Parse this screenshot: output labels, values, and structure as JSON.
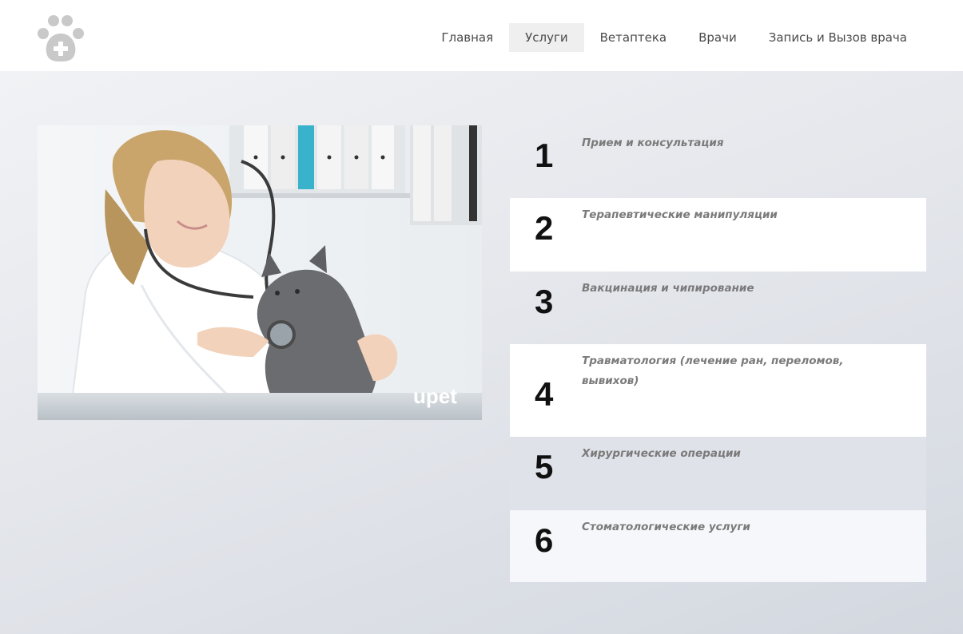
{
  "nav": {
    "items": [
      {
        "label": "Главная",
        "active": false
      },
      {
        "label": "Услуги",
        "active": true
      },
      {
        "label": "Ветаптека",
        "active": false
      },
      {
        "label": "Врачи",
        "active": false
      },
      {
        "label": "Запись и Вызов врача",
        "active": false
      }
    ]
  },
  "logo": {
    "icon": "paw-plus-icon"
  },
  "hero_image": {
    "watermark": "upet",
    "subject": "veterinarian-with-kitten"
  },
  "services": [
    {
      "number": "1",
      "title": "Прием и консультация",
      "bg": "transparent"
    },
    {
      "number": "2",
      "title": "Терапевтические манипуляции",
      "bg": "#ffffff"
    },
    {
      "number": "3",
      "title": "Вакцинация и чипирование",
      "bg": "transparent"
    },
    {
      "number": "4",
      "title": "Травматология (лечение ран, переломов, вывихов)",
      "bg": "#ffffff"
    },
    {
      "number": "5",
      "title": "Хирургические операции",
      "bg": "#dfe2e8"
    },
    {
      "number": "6",
      "title": "Стоматологические услуги",
      "bg": "#f6f7fa"
    }
  ],
  "colors": {
    "accent_nav_bg": "#efefef",
    "number": "#111111",
    "service_title": "#7a7a7a"
  }
}
